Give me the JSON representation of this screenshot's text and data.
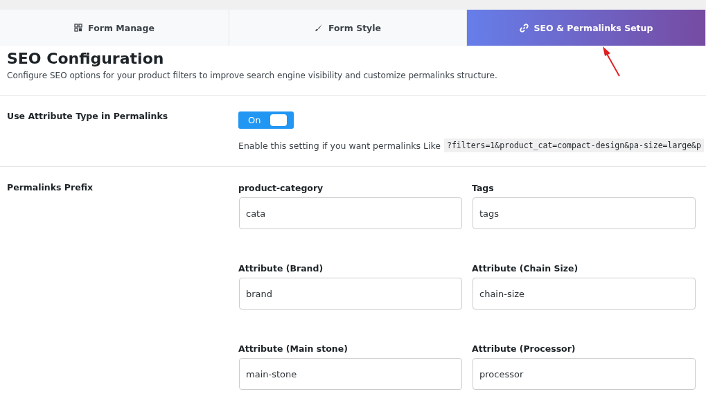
{
  "tabs": [
    {
      "label": "Form Manage",
      "selected": false
    },
    {
      "label": "Form Style",
      "selected": false
    },
    {
      "label": "SEO & Permalinks Setup",
      "selected": true
    }
  ],
  "header": {
    "title": "SEO Configuration",
    "description": "Configure SEO options for your product filters to improve search engine visibility and customize permalinks structure."
  },
  "settings": [
    {
      "kind": "toggle",
      "label": "Use Attribute Type in Permalinks",
      "toggle": {
        "label": "On",
        "on": true
      },
      "help": "Enable this setting if you want permalinks Like",
      "example": "?filters=1&product_cat=compact-design&pa-size=large&p"
    },
    {
      "kind": "fields",
      "label": "Permalinks Prefix",
      "fields": [
        {
          "label": "product-category",
          "value": "cata"
        },
        {
          "label": "Tags",
          "value": "tags"
        },
        {
          "label": "Attribute (Brand)",
          "value": "brand"
        },
        {
          "label": "Attribute (Chain Size)",
          "value": "chain-size"
        },
        {
          "label": "Attribute (Main stone)",
          "value": "main-stone"
        },
        {
          "label": "Attribute (Processor)",
          "value": "processor"
        }
      ]
    }
  ]
}
